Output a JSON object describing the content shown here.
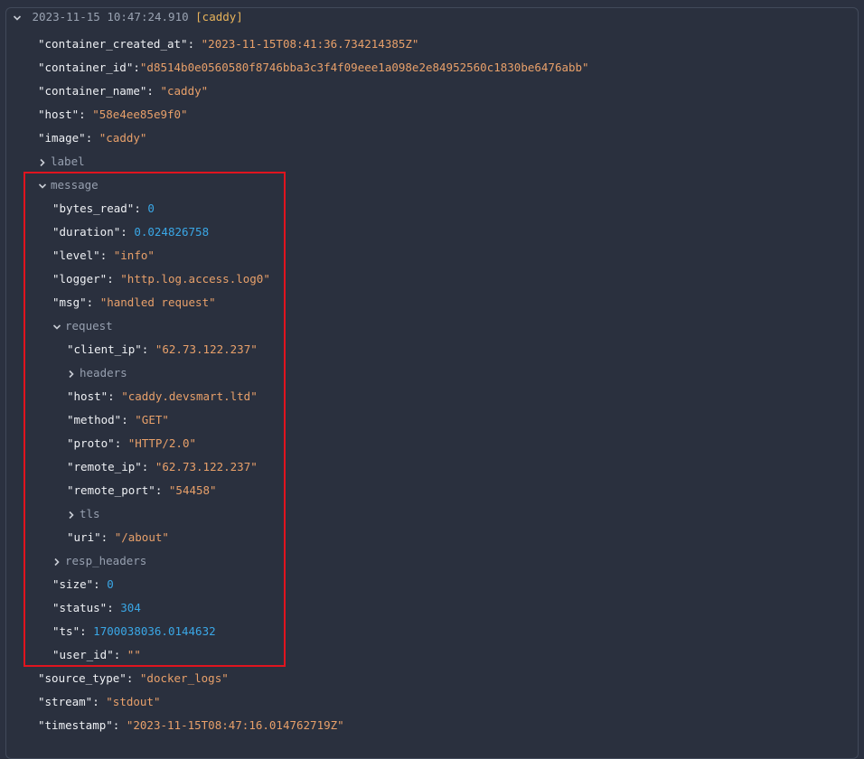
{
  "header": {
    "timestamp": "2023-11-15 10:47:24.910",
    "tag": "[caddy]"
  },
  "entries_top": [
    {
      "key": "\"container_created_at\"",
      "value": "\"2023-11-15T08:41:36.734214385Z\""
    },
    {
      "key": "\"container_id\"",
      "value": "\"d8514b0e0560580f8746bba3c3f4f09eee1a098e2e84952560c1830be6476abb\""
    },
    {
      "key": "\"container_name\"",
      "value": "\"caddy\""
    },
    {
      "key": "\"host\"",
      "value": "\"58e4ee85e9f0\""
    },
    {
      "key": "\"image\"",
      "value": "\"caddy\""
    }
  ],
  "groups": {
    "label": "label",
    "message": "message",
    "request": "request",
    "headers": "headers",
    "tls": "tls",
    "resp_headers": "resp_headers"
  },
  "message": {
    "bytes_read": {
      "key": "\"bytes_read\"",
      "value": "0"
    },
    "duration": {
      "key": "\"duration\"",
      "value": "0.024826758"
    },
    "level": {
      "key": "\"level\"",
      "value": "\"info\""
    },
    "logger": {
      "key": "\"logger\"",
      "value": "\"http.log.access.log0\""
    },
    "msg": {
      "key": "\"msg\"",
      "value": "\"handled request\""
    },
    "size": {
      "key": "\"size\"",
      "value": "0"
    },
    "status": {
      "key": "\"status\"",
      "value": "304"
    },
    "ts": {
      "key": "\"ts\"",
      "value": "1700038036.0144632"
    },
    "user_id": {
      "key": "\"user_id\"",
      "value": "\"\""
    }
  },
  "request": {
    "client_ip": {
      "key": "\"client_ip\"",
      "value": "\"62.73.122.237\""
    },
    "host": {
      "key": "\"host\"",
      "value": "\"caddy.devsmart.ltd\""
    },
    "method": {
      "key": "\"method\"",
      "value": "\"GET\""
    },
    "proto": {
      "key": "\"proto\"",
      "value": "\"HTTP/2.0\""
    },
    "remote_ip": {
      "key": "\"remote_ip\"",
      "value": "\"62.73.122.237\""
    },
    "remote_port": {
      "key": "\"remote_port\"",
      "value": "\"54458\""
    },
    "uri": {
      "key": "\"uri\"",
      "value": "\"/about\""
    }
  },
  "entries_bottom": [
    {
      "key": "\"source_type\"",
      "value": "\"docker_logs\""
    },
    {
      "key": "\"stream\"",
      "value": "\"stdout\""
    },
    {
      "key": "\"timestamp\"",
      "value": "\"2023-11-15T08:47:16.014762719Z\""
    }
  ],
  "colors": {
    "background": "#2b3140",
    "string": "#e8a06a",
    "number": "#3aa7e6",
    "tag": "#e8b35a",
    "highlight_border": "#e0141e"
  }
}
